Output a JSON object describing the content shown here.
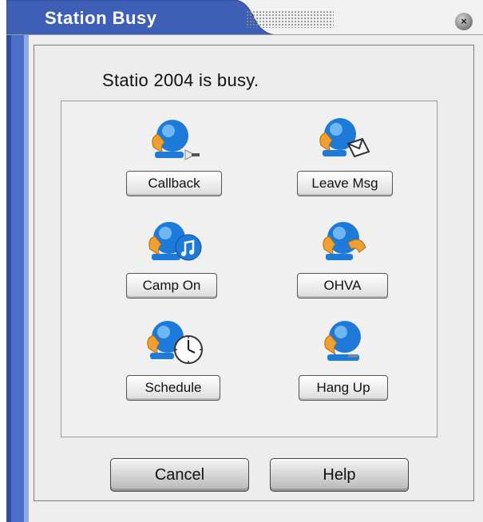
{
  "window": {
    "title": "Station Busy",
    "close_glyph": "×"
  },
  "message": "Statio 2004 is busy.",
  "options": [
    {
      "label": "Callback",
      "icon": "phone-callback-icon"
    },
    {
      "label": "Leave Msg",
      "icon": "phone-message-icon"
    },
    {
      "label": "Camp On",
      "icon": "phone-music-icon"
    },
    {
      "label": "OHVA",
      "icon": "phone-ohva-icon"
    },
    {
      "label": "Schedule",
      "icon": "phone-clock-icon"
    },
    {
      "label": "Hang Up",
      "icon": "phone-hangup-icon"
    }
  ],
  "buttons": {
    "cancel": "Cancel",
    "help": "Help"
  },
  "colors": {
    "title_bar_blue": "#3d5fb5",
    "frame_blue": "#4a6fc8",
    "phone_orange": "#f0a030",
    "phone_blue": "#1e7ad8"
  }
}
